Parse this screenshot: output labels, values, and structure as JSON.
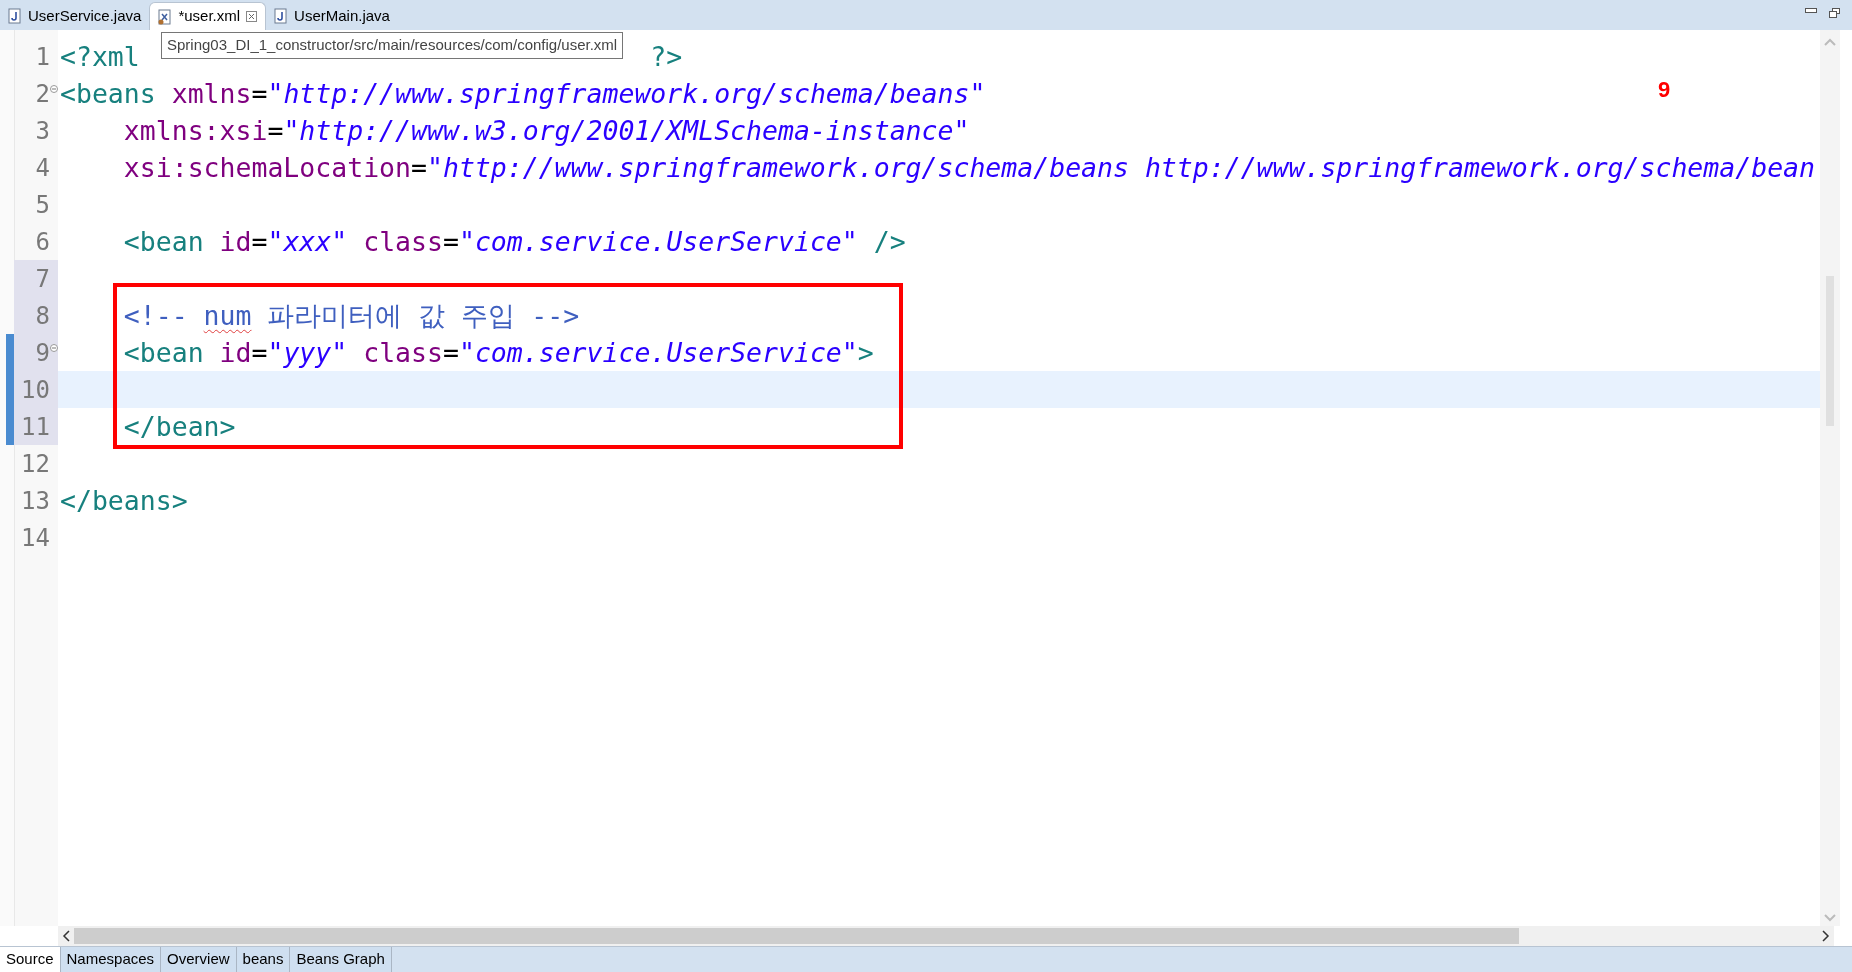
{
  "editor_tabs": [
    {
      "label": "UserService.java",
      "kind": "java",
      "selected": false,
      "closable": false
    },
    {
      "label": "*user.xml",
      "kind": "xml",
      "selected": true,
      "closable": true
    },
    {
      "label": "UserMain.java",
      "kind": "java",
      "selected": false,
      "closable": false
    }
  ],
  "tooltip": "Spring03_DI_1_constructor/src/main/resources/com/config/user.xml",
  "annotation": "9",
  "lines": [
    {
      "number": "1",
      "fold": false,
      "range": false,
      "changed": false,
      "current": false,
      "segments": [
        {
          "kind": "tag",
          "text": "<?xml"
        },
        {
          "kind": "tag",
          "text": "?>"
        }
      ]
    },
    {
      "number": "2",
      "fold": true,
      "range": false,
      "changed": false,
      "current": false,
      "segments": [
        {
          "kind": "tag",
          "text": "<beans"
        },
        {
          "kind": "attr",
          "text": " xmlns"
        },
        {
          "kind": "plain",
          "text": "="
        },
        {
          "kind": "value",
          "text": "\"http://www.springframework.org/schema/beans\""
        }
      ]
    },
    {
      "number": "3",
      "fold": false,
      "range": false,
      "changed": false,
      "current": false,
      "segments": [
        {
          "kind": "attr",
          "text": "    xmlns:xsi"
        },
        {
          "kind": "plain",
          "text": "="
        },
        {
          "kind": "value",
          "text": "\"http://www.w3.org/2001/XMLSchema-instance\""
        }
      ]
    },
    {
      "number": "4",
      "fold": false,
      "range": false,
      "changed": false,
      "current": false,
      "segments": [
        {
          "kind": "attr",
          "text": "    xsi:schemaLocation"
        },
        {
          "kind": "plain",
          "text": "="
        },
        {
          "kind": "value",
          "text": "\"http://www.springframework.org/schema/beans http://www.springframework.org/schema/bean"
        }
      ]
    },
    {
      "number": "5",
      "fold": false,
      "range": false,
      "changed": false,
      "current": false
    },
    {
      "number": "6",
      "fold": false,
      "range": false,
      "changed": false,
      "current": false,
      "segments": [
        {
          "kind": "tag",
          "text": "    <bean"
        },
        {
          "kind": "attr",
          "text": " id"
        },
        {
          "kind": "plain",
          "text": "="
        },
        {
          "kind": "value",
          "text": "\"xxx\""
        },
        {
          "kind": "attr",
          "text": " class"
        },
        {
          "kind": "plain",
          "text": "="
        },
        {
          "kind": "value",
          "text": "\"com.service.UserService\""
        },
        {
          "kind": "tag",
          "text": " />"
        }
      ]
    },
    {
      "number": "7",
      "fold": false,
      "range": true,
      "changed": false,
      "current": false
    },
    {
      "number": "8",
      "fold": false,
      "range": true,
      "changed": false,
      "current": false,
      "segments": [
        {
          "kind": "comment",
          "text": "    <!-- "
        },
        {
          "kind": "comment_flagged",
          "text": "num"
        },
        {
          "kind": "comment",
          "text": " 파라미터에 값 주입 -->"
        }
      ]
    },
    {
      "number": "9",
      "fold": true,
      "range": true,
      "changed": true,
      "current": false,
      "segments": [
        {
          "kind": "tag",
          "text": "    <bean"
        },
        {
          "kind": "attr",
          "text": " id"
        },
        {
          "kind": "plain",
          "text": "="
        },
        {
          "kind": "value",
          "text": "\"yyy\""
        },
        {
          "kind": "attr",
          "text": " class"
        },
        {
          "kind": "plain",
          "text": "="
        },
        {
          "kind": "value",
          "text": "\"com.service.UserService\""
        },
        {
          "kind": "tag",
          "text": ">"
        }
      ]
    },
    {
      "number": "10",
      "fold": false,
      "range": true,
      "changed": true,
      "current": true
    },
    {
      "number": "11",
      "fold": false,
      "range": true,
      "changed": true,
      "current": false,
      "segments": [
        {
          "kind": "tag",
          "text": "    </bean>"
        }
      ]
    },
    {
      "number": "12",
      "fold": false,
      "range": false,
      "changed": false,
      "current": false
    },
    {
      "number": "13",
      "fold": false,
      "range": false,
      "changed": false,
      "current": false,
      "segments": [
        {
          "kind": "tag",
          "text": "</beans>"
        }
      ]
    },
    {
      "number": "14",
      "fold": false,
      "range": false,
      "changed": false,
      "current": false
    }
  ],
  "bottom_tabs": [
    {
      "label": "Source",
      "selected": true
    },
    {
      "label": "Namespaces",
      "selected": false
    },
    {
      "label": "Overview",
      "selected": false
    },
    {
      "label": "beans",
      "selected": false
    },
    {
      "label": "Beans Graph",
      "selected": false
    }
  ]
}
